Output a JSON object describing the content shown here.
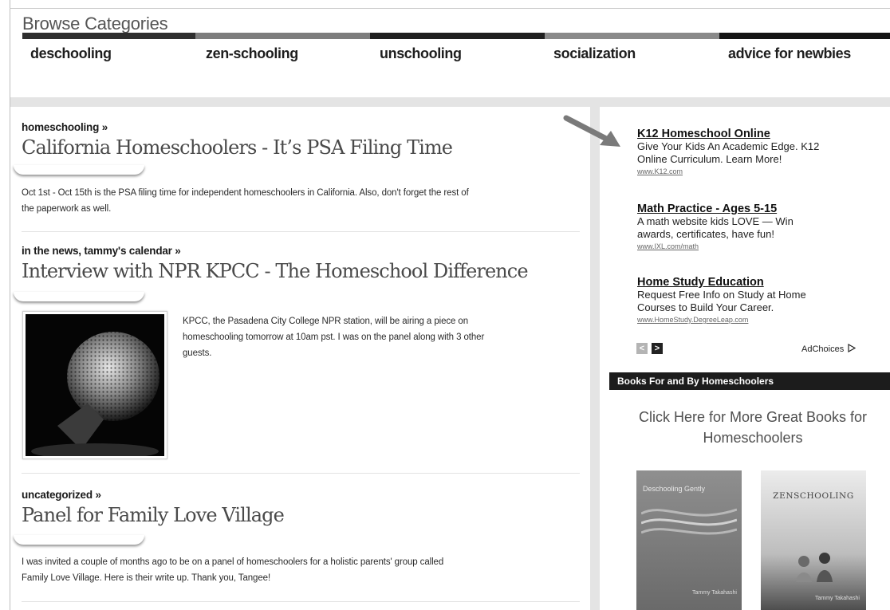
{
  "browse": {
    "title": "Browse Categories",
    "categories": [
      "deschooling",
      "zen-schooling",
      "unschooling",
      "socialization",
      "advice for newbies"
    ]
  },
  "posts": [
    {
      "categories": "homeschooling »",
      "title": "California Homeschoolers - It’s PSA Filing Time",
      "excerpt_line1": "Oct 1st - Oct 15th is the PSA filing time for independent homeschoolers in California. Also, don't forget the rest of",
      "excerpt_line2": "the paperwork as well."
    },
    {
      "categories": "in the news, tammy's calendar »",
      "title": "Interview with NPR KPCC - The Homeschool Difference",
      "excerpt_line1": "KPCC, the Pasadena City College NPR station, will be airing a piece on",
      "excerpt_line2": "homeschooling tomorrow at 10am pst. I was on the panel along with 3 other",
      "excerpt_line3": "guests."
    },
    {
      "categories": "uncategorized »",
      "title": "Panel for Family Love Village",
      "excerpt_line1": "I was invited a couple of months ago to be on a panel of homeschoolers for a holistic parents' group called",
      "excerpt_line2": "Family Love Village. Here is their write up. Thank you, Tangee!"
    }
  ],
  "ads": [
    {
      "title": "K12 Homeschool Online",
      "line1": "Give Your Kids An Academic Edge. K12",
      "line2": "Online Curriculum. Learn More!",
      "url": "www.K12.com"
    },
    {
      "title": "Math Practice - Ages 5-15",
      "line1": "A math website kids LOVE — Win",
      "line2": "awards, certificates, have fun!",
      "url": "www.IXL.com/math"
    },
    {
      "title": "Home Study Education",
      "line1": "Request Free Info on Study at Home",
      "line2": "Courses to Build Your Career.",
      "url": "www.HomeStudy.DegreeLeap.com"
    }
  ],
  "ad_nav": {
    "prev": "<",
    "next": ">",
    "adchoices": "AdChoices"
  },
  "books_widget": {
    "heading": "Books For and By Homeschoolers",
    "link_line1": "Click Here for More Great Books for",
    "link_line2": "Homeschoolers",
    "book1_title": "Deschooling Gently",
    "book1_author": "Tammy Takahashi",
    "book2_title": "ZENSCHOOLING",
    "book2_author": "Tammy Takahashi"
  },
  "colors": {
    "category_bars": [
      "#2e2e2e",
      "#7d7d7d",
      "#1f1f1f",
      "#8a8a8a",
      "#141414"
    ],
    "accent": "#1c1c1c"
  },
  "icons": {
    "annotation_arrow": "arrow-icon",
    "ad_prev": "chevron-left-icon",
    "ad_next": "chevron-right-icon",
    "adchoices": "adchoices-triangle-icon"
  }
}
